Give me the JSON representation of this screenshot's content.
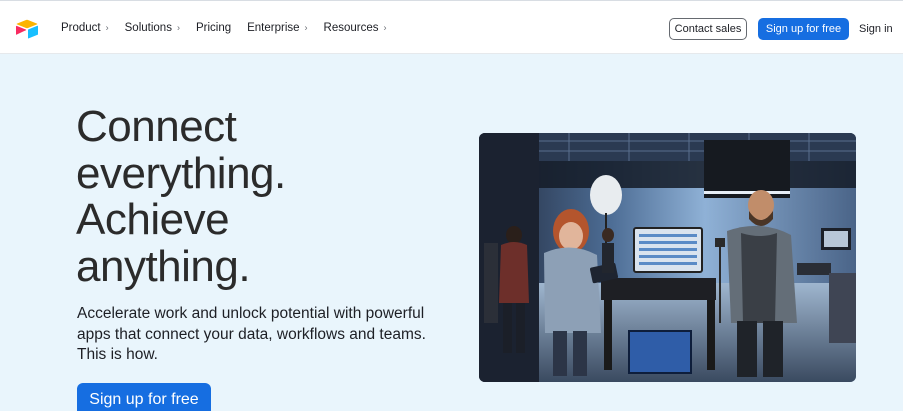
{
  "header": {
    "logo_name": "airtable-logo",
    "nav": [
      {
        "label": "Product",
        "has_chevron": true
      },
      {
        "label": "Solutions",
        "has_chevron": true
      },
      {
        "label": "Pricing",
        "has_chevron": false
      },
      {
        "label": "Enterprise",
        "has_chevron": true
      },
      {
        "label": "Resources",
        "has_chevron": true
      }
    ],
    "chevron_glyph": "›",
    "contact_sales_label": "Contact sales",
    "signup_label": "Sign up for free",
    "signin_label": "Sign in"
  },
  "hero": {
    "title_lines": [
      "Connect",
      "everything.",
      "Achieve",
      "anything."
    ],
    "subtitle": "Accelerate work and unlock potential with powerful apps that connect your data, workflows and teams. This is how.",
    "cta_label": "Sign up for free",
    "photo_icon": "studio-photo"
  },
  "colors": {
    "accent": "#166ee1",
    "page_background": "#e9f5fc",
    "header_background": "#ffffff",
    "text": "#1d1f25"
  }
}
